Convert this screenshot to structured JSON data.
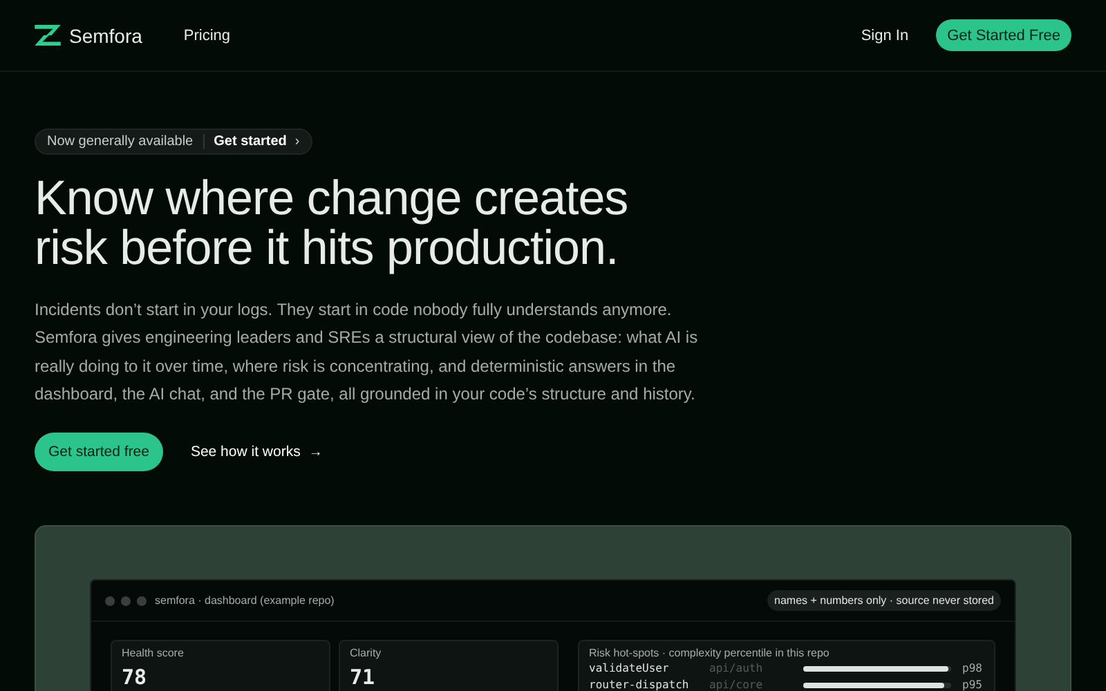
{
  "nav": {
    "brand": "Semfora",
    "links": [
      "Pricing"
    ],
    "sign_in": "Sign In",
    "cta": "Get Started Free"
  },
  "announcement": {
    "label": "Now generally available",
    "link": "Get started",
    "chevron": "›"
  },
  "hero": {
    "headline": "Know where change creates risk before it hits production.",
    "body": "Incidents don’t start in your logs. They start in code nobody fully understands anymore. Semfora gives engineering leaders and SREs a structural view of the codebase: what AI is really doing to it over time, where risk is concentrating, and deterministic answers in the dashboard, the AI chat, and the PR gate, all grounded in your code’s structure and history.",
    "primary": "Get started free",
    "secondary": "See how it works",
    "secondary_arrow": "→"
  },
  "dashboard": {
    "title": "semfora · dashboard (example repo)",
    "badge": "names + numbers only · source never stored",
    "metrics": [
      {
        "label": "Health score",
        "value": "78"
      },
      {
        "label": "Clarity",
        "value": "71"
      }
    ],
    "hotspots": {
      "title": "Risk hot-spots · complexity percentile in this repo",
      "rows": [
        {
          "name": "validateUser",
          "path": "api/auth",
          "level": 0.98,
          "percentile": "p98"
        },
        {
          "name": "router-dispatch",
          "path": "api/core",
          "level": 0.95,
          "percentile": "p95"
        }
      ]
    }
  }
}
